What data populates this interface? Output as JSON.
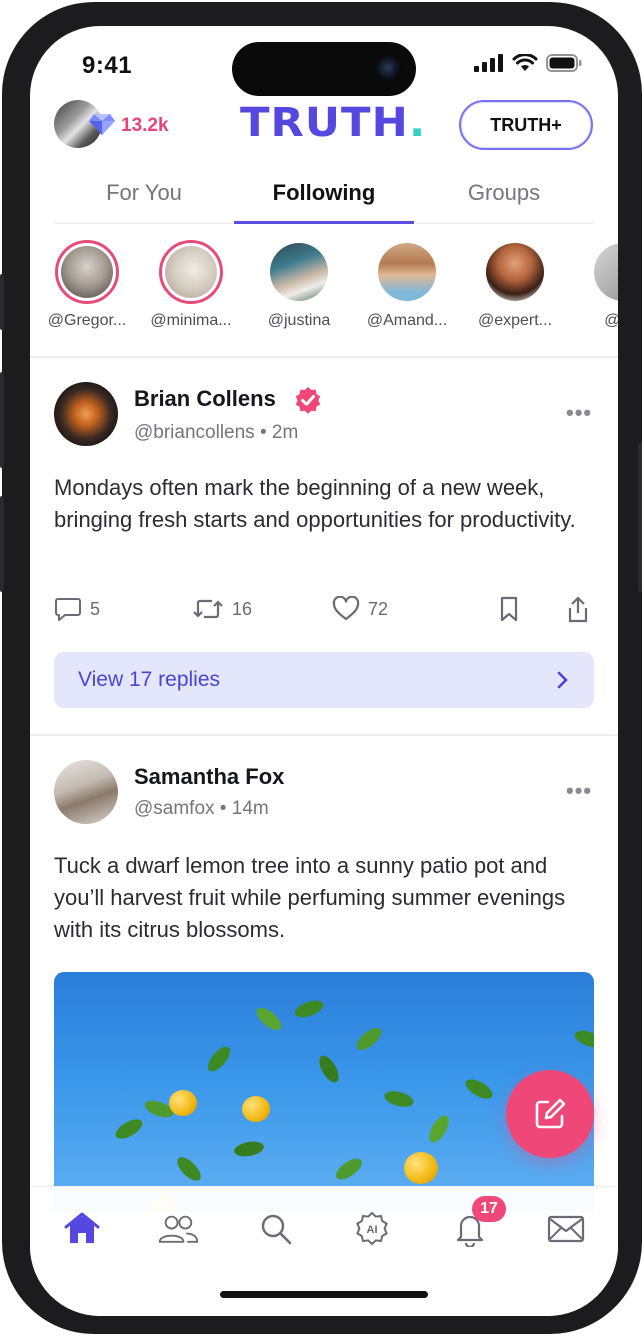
{
  "status_bar": {
    "time": "9:41"
  },
  "header": {
    "gem_count": "13.2k",
    "logo_text": "TRUTH",
    "logo_dot": ".",
    "truth_plus_label": "TRUTH+"
  },
  "tabs": [
    {
      "label": "For You",
      "active": false
    },
    {
      "label": "Following",
      "active": true
    },
    {
      "label": "Groups",
      "active": false
    }
  ],
  "stories": [
    {
      "handle": "@Gregor...",
      "ring": true
    },
    {
      "handle": "@minima...",
      "ring": true
    },
    {
      "handle": "@justina",
      "ring": false
    },
    {
      "handle": "@Amand...",
      "ring": false
    },
    {
      "handle": "@expert...",
      "ring": false
    },
    {
      "handle": "@pai",
      "ring": false
    }
  ],
  "posts": [
    {
      "name": "Brian Collens",
      "verified": true,
      "handle": "@briancollens",
      "time": "2m",
      "text": "Mondays often mark the beginning of a new week, bringing fresh starts and opportunities for productivity.",
      "replies_count": "5",
      "retruths_count": "16",
      "likes_count": "72",
      "view_replies_label": "View 17 replies"
    },
    {
      "name": "Samantha Fox",
      "verified": false,
      "handle": "@samfox",
      "time": "14m",
      "text": "Tuck a dwarf lemon tree into a sunny patio pot and you’ll harvest fruit while perfuming summer evenings with its citrus blossoms."
    }
  ],
  "bottom_nav": {
    "items": [
      "home-icon",
      "people-icon",
      "search-icon",
      "ai-icon",
      "bell-icon",
      "mail-icon"
    ],
    "notifications_badge": "17"
  },
  "colors": {
    "brand": "#5548e0",
    "accent": "#ef4777",
    "logo_dot": "#32d2c2"
  }
}
